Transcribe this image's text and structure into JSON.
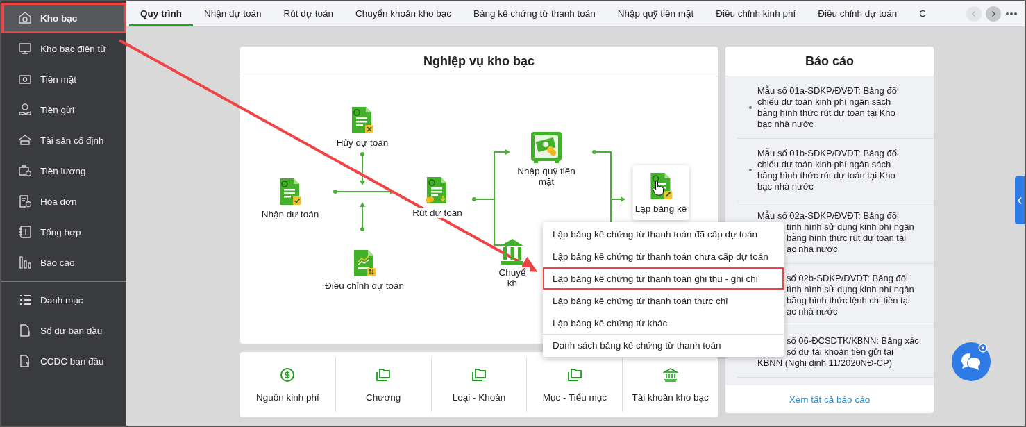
{
  "sidebar": {
    "sections": [
      {
        "items": [
          {
            "label": "Kho bạc",
            "selected": true,
            "highlighted": true
          },
          {
            "label": "Kho bạc điện tử",
            "selected": false,
            "highlighted": false
          },
          {
            "label": "Tiền mặt",
            "selected": false,
            "highlighted": false
          },
          {
            "label": "Tiền gửi",
            "selected": false,
            "highlighted": false
          },
          {
            "label": "Tài sản cố định",
            "selected": false,
            "highlighted": false
          },
          {
            "label": "Tiền lương",
            "selected": false,
            "highlighted": false
          },
          {
            "label": "Hóa đơn",
            "selected": false,
            "highlighted": false
          },
          {
            "label": "Tổng hợp",
            "selected": false,
            "highlighted": false
          },
          {
            "label": "Báo cáo",
            "selected": false,
            "highlighted": false
          }
        ]
      },
      {
        "items": [
          {
            "label": "Danh mục",
            "selected": false,
            "highlighted": false
          },
          {
            "label": "Số dư ban đầu",
            "selected": false,
            "highlighted": false
          },
          {
            "label": "CCDC ban đầu",
            "selected": false,
            "highlighted": false
          }
        ]
      }
    ]
  },
  "tabs": [
    {
      "label": "Quy trình",
      "selected": true
    },
    {
      "label": "Nhận dự toán",
      "selected": false
    },
    {
      "label": "Rút dự toán",
      "selected": false
    },
    {
      "label": "Chuyển khoản kho bạc",
      "selected": false
    },
    {
      "label": "Bảng kê chứng từ thanh toán",
      "selected": false
    },
    {
      "label": "Nhập quỹ tiền mặt",
      "selected": false
    },
    {
      "label": "Điều chỉnh kinh phí",
      "selected": false
    },
    {
      "label": "Điều chỉnh dự toán",
      "selected": false
    },
    {
      "label": "C",
      "selected": false
    }
  ],
  "tab_nav": {
    "previous": {
      "disabled": true
    },
    "next": {
      "disabled": false
    }
  },
  "diagram": {
    "title": "Nghiệp vụ kho bạc",
    "nodes": [
      {
        "label": "Hủy dự toán",
        "hovered": false
      },
      {
        "label": "Nhận dự toán",
        "hovered": false
      },
      {
        "label": "Rút dự toán",
        "hovered": false
      },
      {
        "label": "Điều chỉnh dự toán",
        "hovered": false
      },
      {
        "label": "Nhập quỹ tiền mặt",
        "hovered": false
      },
      {
        "label": "Chuyể kh",
        "hovered": false
      },
      {
        "label": "Lập bảng kê",
        "hovered": true
      }
    ]
  },
  "context_menu": {
    "items": [
      {
        "label": "Lập bảng kê chứng từ thanh toán đã cấp dự toán",
        "highlighted": false,
        "divider_before": false
      },
      {
        "label": "Lập bảng kê chứng từ thanh toán chưa cấp dự toán",
        "highlighted": false,
        "divider_before": false
      },
      {
        "label": "Lập bảng kê chứng từ thanh toán ghi thu - ghi chi",
        "highlighted": true,
        "divider_before": false
      },
      {
        "label": "Lập bảng kê chứng từ thanh toán thực chi",
        "highlighted": false,
        "divider_before": false
      },
      {
        "label": "Lập bảng kê chứng từ khác",
        "highlighted": false,
        "divider_before": false
      },
      {
        "label": "Danh sách bảng kê chứng từ thanh toán",
        "highlighted": false,
        "divider_before": true
      }
    ]
  },
  "quick_links": [
    {
      "label": "Nguồn kinh phí"
    },
    {
      "label": "Chương"
    },
    {
      "label": "Loại - Khoản"
    },
    {
      "label": "Mục - Tiểu mục"
    },
    {
      "label": "Tài khoản kho bạc"
    }
  ],
  "reports": {
    "title": "Báo cáo",
    "items": [
      {
        "bullet": true,
        "lines": [
          {
            "text": "Mẫu số 01a-SDKP/ĐVĐT: Bảng đối",
            "clipped": false
          },
          {
            "text": "chiếu dự toán kinh phí ngân sách",
            "clipped": false
          },
          {
            "text": "bằng hình thức rút dự toán tại Kho",
            "clipped": false
          },
          {
            "text": "bạc nhà nước",
            "clipped": false
          }
        ]
      },
      {
        "bullet": true,
        "lines": [
          {
            "text": "Mẫu số 01b-SDKP/ĐVĐT: Bảng đối",
            "clipped": false
          },
          {
            "text": "chiếu dự toán kinh phí ngân sách",
            "clipped": false
          },
          {
            "text": "bằng hình thức rút dự toán tại Kho",
            "clipped": false
          },
          {
            "text": "bạc nhà nước",
            "clipped": false
          }
        ]
      },
      {
        "bullet": false,
        "lines": [
          {
            "text": "Mẫu số 02a-SDKP/ĐVĐT: Bảng đối",
            "clipped": false
          },
          {
            "text": "tình hình sử dụng kinh phí ngân",
            "clipped": true
          },
          {
            "text": "bằng hình thức rút dự toán tại",
            "clipped": true
          },
          {
            "text": "ạc nhà nước",
            "clipped": true
          }
        ]
      },
      {
        "bullet": false,
        "lines": [
          {
            "text": "số 02b-SDKP/ĐVĐT: Bảng đối",
            "clipped": true
          },
          {
            "text": "tình hình sử dụng kinh phí ngân",
            "clipped": true
          },
          {
            "text": "bằng hình thức lệnh chi tiền tại",
            "clipped": true
          },
          {
            "text": "ạc nhà nước",
            "clipped": true
          }
        ]
      },
      {
        "bullet": false,
        "lines": [
          {
            "text": "số 06-ĐCSDTK/KBNN: Bảng xác",
            "clipped": true
          },
          {
            "text": "số dư tài khoản tiền gửi tại",
            "clipped": true
          },
          {
            "text": "KBNN (Nghị định 11/2020NĐ-CP)",
            "clipped": false
          }
        ]
      }
    ],
    "footer_link": "Xem tất cả báo cáo"
  }
}
